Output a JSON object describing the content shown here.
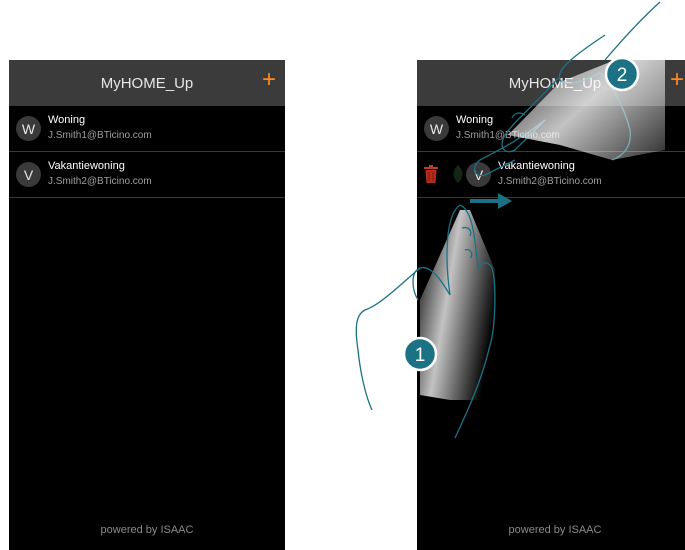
{
  "app": {
    "title": "MyHOME_Up",
    "add_icon": "+",
    "footer": "powered by ISAAC"
  },
  "accounts": [
    {
      "initial": "W",
      "name": "Woning",
      "email": "J.Smith1@BTicino.com"
    },
    {
      "initial": "V",
      "name": "Vakantiewoning",
      "email": "J.Smith2@BTicino.com"
    }
  ],
  "right_phone": {
    "title": "MyHOME_Up",
    "row1_initial": "W",
    "row1_name": "Woning",
    "row1_email": "J.Smith1@BTicino.com",
    "swiped_initial": "V",
    "swiped_name": "Vakantiewoning",
    "swiped_email": "J.Smith2@BTicino.com",
    "trash_icon": "trash-icon",
    "edit_icon": "leaf-icon"
  },
  "steps": {
    "step1": "1",
    "step2": "2"
  },
  "colors": {
    "accent": "#ff8a1f",
    "badge": "#1c7285",
    "arrow": "#1c7285"
  }
}
